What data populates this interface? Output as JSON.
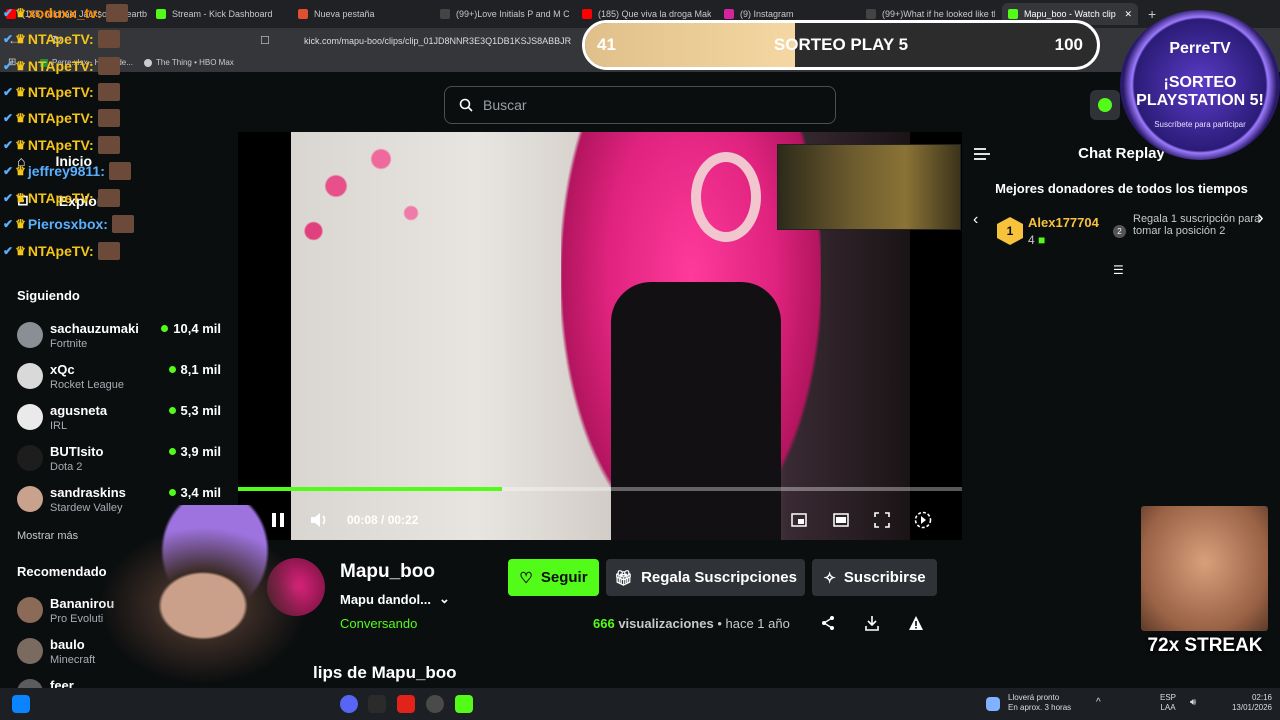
{
  "browser": {
    "tabs": [
      {
        "label": "(185) Michael Jackson - Heartb",
        "color": "#ff0000"
      },
      {
        "label": "Stream - Kick Dashboard",
        "color": "#53fc18"
      },
      {
        "label": "Nueva pestaña",
        "color": "#e04f2f"
      },
      {
        "label": "(99+)Love Initials P and M Cu",
        "color": "#111111"
      },
      {
        "label": "(185) Que viva la droga Makan",
        "color": "#ff0000"
      },
      {
        "label": "(9) Instagram",
        "color": "#d6249f"
      },
      {
        "label": "(99+)What if he looked like th",
        "color": "#111111"
      },
      {
        "label": "Mapu_boo - Watch clip",
        "color": "#53fc18"
      }
    ],
    "url": "kick.com/mapu-boo/clips/clip_01JD8NNR3E3Q1DB1KSJS8ABBJR",
    "bookmarks": [
      "Perre.xlsx - Hojas de...",
      "The Thing • HBO Max"
    ]
  },
  "site": {
    "search_placeholder": "Buscar",
    "nav": {
      "inicio": "Inicio",
      "explorar": "Explorar"
    },
    "following_title": "Siguiendo",
    "following": [
      {
        "name": "sachauzumaki",
        "game": "Fortnite",
        "viewers": "10,4 mil"
      },
      {
        "name": "xQc",
        "game": "Rocket League",
        "viewers": "8,1 mil"
      },
      {
        "name": "agusneta",
        "game": "IRL",
        "viewers": "5,3 mil"
      },
      {
        "name": "BUTIsito",
        "game": "Dota 2",
        "viewers": "3,9 mil"
      },
      {
        "name": "sandraskins",
        "game": "Stardew Valley",
        "viewers": "3,4 mil"
      }
    ],
    "show_more": "Mostrar más",
    "recommended_title": "Recomendado",
    "recommended": [
      {
        "name": "Bananirou",
        "game": "Pro Evoluti"
      },
      {
        "name": "baulo",
        "game": "Minecraft"
      },
      {
        "name": "feer",
        "game": ""
      }
    ]
  },
  "player": {
    "time": "00:08 / 00:22",
    "progress_fraction": 0.365,
    "playing": true
  },
  "clip": {
    "channel": "Mapu_boo",
    "title": "Mapu dandol...",
    "category": "Conversando",
    "follow_label": "Seguir",
    "gift_label": "Regala Suscripciones",
    "subscribe_label": "Suscribirse",
    "views_count": "666",
    "views_label": "visualizaciones",
    "age": "hace 1 año",
    "more_clips_heading": "lips de Mapu_boo"
  },
  "chat": {
    "title": "Chat Replay",
    "donors_title": "Mejores donadores de todos los tiempos",
    "top_donor_rank": "1",
    "top_donor_name": "Alex177704",
    "top_donor_count": "4",
    "second_rank": "2",
    "second_cta": "Regala 1 suscripción para tomar la posición 2"
  },
  "overlay": {
    "sorteo_current": "41",
    "sorteo_label": "SORTEO PLAY 5",
    "sorteo_goal": "100",
    "sorteo_fraction": 0.41,
    "badge_line1": "PerreTV",
    "badge_line2": "¡SORTEO",
    "badge_line3": "PLAYSTATION 5!",
    "badge_line4": "Suscríbete para participar",
    "streak_label": "72x STREAK",
    "chat_lines": [
      {
        "user": "xoduxx_tv:",
        "color": "#ff8a00"
      },
      {
        "user": "NTApeTV:",
        "color": "#f5c518"
      },
      {
        "user": "NTApeTV:",
        "color": "#f5c518"
      },
      {
        "user": "NTApeTV:",
        "color": "#f5c518"
      },
      {
        "user": "NTApeTV:",
        "color": "#f5c518"
      },
      {
        "user": "NTApeTV:",
        "color": "#f5c518"
      },
      {
        "user": "jeffrey9811:",
        "color": "#5ab0ff"
      },
      {
        "user": "NTApeTV:",
        "color": "#f5c518"
      },
      {
        "user": "Pierosxbox:",
        "color": "#5ab0ff"
      },
      {
        "user": "NTApeTV:",
        "color": "#f5c518"
      }
    ]
  },
  "taskbar": {
    "weather_title": "Lloverá pronto",
    "weather_sub": "En aprox. 3 horas",
    "lang_top": "ESP",
    "lang_bottom": "LAA",
    "time": "02:16",
    "date": "13/01/2026"
  },
  "colors": {
    "accent": "#53fc18",
    "panel": "#2f3337",
    "bg": "#0b0e0f"
  }
}
